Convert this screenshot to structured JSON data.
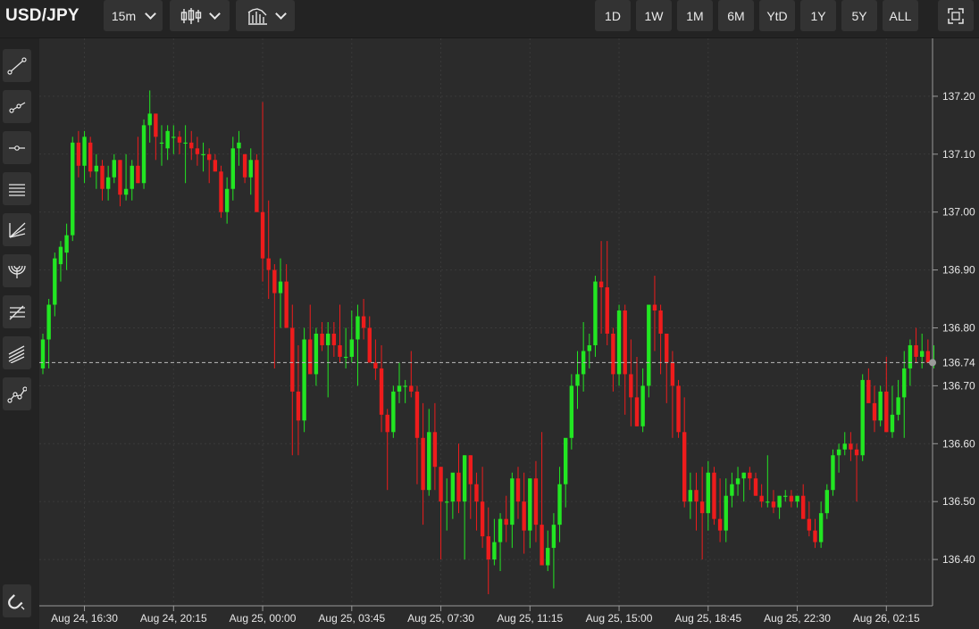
{
  "symbol": "USD/JPY",
  "toolbar": {
    "interval": "15m",
    "chart_type_icon": "candlestick-icon",
    "indicators_icon": "indicators-icon",
    "ranges": [
      "1D",
      "1W",
      "1M",
      "6M",
      "YtD",
      "1Y",
      "5Y",
      "ALL"
    ],
    "fullscreen_icon": "fullscreen-icon"
  },
  "tools": [
    "trend-line-icon",
    "ray-icon",
    "horizontal-line-icon",
    "parallel-channel-icon",
    "pitchfork-icon",
    "fibonacci-arc-icon",
    "fibonacci-retracement-icon",
    "fibonacci-channel-icon",
    "polyline-icon"
  ],
  "magnet_icon": "magnet-icon",
  "colors": {
    "up": "#22e622",
    "down": "#ee1c1c",
    "background": "#2b2b2b",
    "grid": "#3a3a3a",
    "text": "#e6e6e6"
  },
  "chart_data": {
    "type": "candlestick",
    "current_price": 136.74,
    "current_price_label": "136.74",
    "ylim": [
      136.32,
      137.3
    ],
    "yticks": [
      136.4,
      136.5,
      136.6,
      136.7,
      136.8,
      136.9,
      137.0,
      137.1,
      137.2
    ],
    "ytick_labels": [
      "136.40",
      "136.50",
      "136.60",
      "136.70",
      "136.80",
      "136.90",
      "137.00",
      "137.10",
      "137.20"
    ],
    "xtick_labels": [
      "Aug 24, 16:30",
      "Aug 24, 20:15",
      "Aug 25, 00:00",
      "Aug 25, 03:45",
      "Aug 25, 07:30",
      "Aug 25, 11:15",
      "Aug 25, 15:00",
      "Aug 25, 18:45",
      "Aug 25, 22:30",
      "Aug 26, 02:15"
    ],
    "xtick_index": [
      7,
      22,
      37,
      52,
      67,
      82,
      97,
      112,
      127,
      142
    ],
    "candles": [
      [
        136.73,
        136.79,
        136.72,
        136.78
      ],
      [
        136.78,
        136.85,
        136.73,
        136.84
      ],
      [
        136.84,
        136.93,
        136.82,
        136.92
      ],
      [
        136.91,
        136.95,
        136.88,
        136.94
      ],
      [
        136.93,
        136.98,
        136.9,
        136.96
      ],
      [
        136.96,
        137.13,
        136.95,
        137.12
      ],
      [
        137.12,
        137.14,
        137.06,
        137.08
      ],
      [
        137.08,
        137.14,
        137.05,
        137.13
      ],
      [
        137.12,
        137.13,
        137.06,
        137.07
      ],
      [
        137.07,
        137.1,
        137.04,
        137.08
      ],
      [
        137.08,
        137.09,
        137.02,
        137.04
      ],
      [
        137.04,
        137.08,
        137.02,
        137.06
      ],
      [
        137.06,
        137.1,
        137.05,
        137.09
      ],
      [
        137.09,
        137.09,
        137.01,
        137.03
      ],
      [
        137.03,
        137.1,
        137.02,
        137.04
      ],
      [
        137.04,
        137.09,
        137.02,
        137.08
      ],
      [
        137.08,
        137.13,
        137.05,
        137.05
      ],
      [
        137.05,
        137.16,
        137.04,
        137.15
      ],
      [
        137.15,
        137.21,
        137.12,
        137.17
      ],
      [
        137.17,
        137.17,
        137.09,
        137.13
      ],
      [
        137.12,
        137.15,
        137.08,
        137.12
      ],
      [
        137.11,
        137.15,
        137.09,
        137.14
      ],
      [
        137.13,
        137.15,
        137.1,
        137.13
      ],
      [
        137.13,
        137.14,
        137.1,
        137.12
      ],
      [
        137.12,
        137.15,
        137.05,
        137.12
      ],
      [
        137.12,
        137.14,
        137.09,
        137.11
      ],
      [
        137.11,
        137.13,
        137.08,
        137.1
      ],
      [
        137.1,
        137.12,
        137.07,
        137.1
      ],
      [
        137.1,
        137.11,
        137.05,
        137.09
      ],
      [
        137.09,
        137.1,
        137.07,
        137.07
      ],
      [
        137.07,
        137.08,
        136.99,
        137.0
      ],
      [
        137.0,
        137.06,
        136.98,
        137.04
      ],
      [
        137.04,
        137.13,
        137.02,
        137.11
      ],
      [
        137.11,
        137.14,
        137.08,
        137.12
      ],
      [
        137.1,
        137.1,
        137.05,
        137.06
      ],
      [
        137.06,
        137.11,
        137.03,
        137.09
      ],
      [
        137.09,
        137.1,
        137.0,
        137.0
      ],
      [
        137.0,
        137.19,
        136.88,
        136.92
      ],
      [
        136.92,
        137.02,
        136.85,
        136.9
      ],
      [
        136.9,
        136.91,
        136.73,
        136.86
      ],
      [
        136.86,
        136.92,
        136.8,
        136.88
      ],
      [
        136.88,
        136.91,
        136.8,
        136.8
      ],
      [
        136.8,
        136.84,
        136.58,
        136.69
      ],
      [
        136.69,
        136.77,
        136.58,
        136.64
      ],
      [
        136.64,
        136.8,
        136.62,
        136.78
      ],
      [
        136.78,
        136.84,
        136.75,
        136.72
      ],
      [
        136.72,
        136.8,
        136.7,
        136.79
      ],
      [
        136.79,
        136.81,
        136.76,
        136.77
      ],
      [
        136.77,
        136.81,
        136.68,
        136.79
      ],
      [
        136.79,
        136.81,
        136.75,
        136.77
      ],
      [
        136.77,
        136.84,
        136.74,
        136.75
      ],
      [
        136.75,
        136.8,
        136.73,
        136.75
      ],
      [
        136.75,
        136.83,
        136.74,
        136.78
      ],
      [
        136.78,
        136.84,
        136.7,
        136.82
      ],
      [
        136.82,
        136.85,
        136.78,
        136.8
      ],
      [
        136.8,
        136.82,
        136.74,
        136.74
      ],
      [
        136.74,
        136.78,
        136.71,
        136.73
      ],
      [
        136.73,
        136.77,
        136.62,
        136.65
      ],
      [
        136.65,
        136.66,
        136.52,
        136.62
      ],
      [
        136.62,
        136.7,
        136.61,
        136.69
      ],
      [
        136.69,
        136.74,
        136.67,
        136.7
      ],
      [
        136.7,
        136.71,
        136.67,
        136.7
      ],
      [
        136.7,
        136.76,
        136.68,
        136.69
      ],
      [
        136.69,
        136.7,
        136.53,
        136.61
      ],
      [
        136.61,
        136.67,
        136.46,
        136.52
      ],
      [
        136.52,
        136.66,
        136.51,
        136.62
      ],
      [
        136.62,
        136.67,
        136.52,
        136.56
      ],
      [
        136.56,
        136.56,
        136.4,
        136.5
      ],
      [
        136.5,
        136.54,
        136.45,
        136.5
      ],
      [
        136.5,
        136.54,
        136.47,
        136.55
      ],
      [
        136.55,
        136.6,
        136.48,
        136.5
      ],
      [
        136.5,
        136.58,
        136.4,
        136.58
      ],
      [
        136.58,
        136.58,
        136.47,
        136.53
      ],
      [
        136.53,
        136.55,
        136.45,
        136.5
      ],
      [
        136.5,
        136.56,
        136.42,
        136.44
      ],
      [
        136.44,
        136.49,
        136.34,
        136.4
      ],
      [
        136.4,
        136.47,
        136.39,
        136.43
      ],
      [
        136.43,
        136.48,
        136.38,
        136.47
      ],
      [
        136.47,
        136.51,
        136.43,
        136.46
      ],
      [
        136.46,
        136.55,
        136.42,
        136.54
      ],
      [
        136.54,
        136.56,
        136.47,
        136.5
      ],
      [
        136.5,
        136.55,
        136.41,
        136.45
      ],
      [
        136.45,
        136.54,
        136.42,
        136.54
      ],
      [
        136.54,
        136.57,
        136.43,
        136.46
      ],
      [
        136.46,
        136.62,
        136.4,
        136.39
      ],
      [
        136.39,
        136.45,
        136.38,
        136.42
      ],
      [
        136.42,
        136.48,
        136.35,
        136.46
      ],
      [
        136.46,
        136.56,
        136.43,
        136.53
      ],
      [
        136.53,
        136.6,
        136.49,
        136.61
      ],
      [
        136.61,
        136.72,
        136.59,
        136.7
      ],
      [
        136.7,
        136.76,
        136.66,
        136.72
      ],
      [
        136.72,
        136.81,
        136.69,
        136.76
      ],
      [
        136.76,
        136.79,
        136.73,
        136.77
      ],
      [
        136.77,
        136.89,
        136.75,
        136.88
      ],
      [
        136.88,
        136.95,
        136.79,
        136.87
      ],
      [
        136.87,
        136.95,
        136.77,
        136.79
      ],
      [
        136.79,
        136.8,
        136.69,
        136.72
      ],
      [
        136.72,
        136.84,
        136.7,
        136.83
      ],
      [
        136.83,
        136.84,
        136.65,
        136.72
      ],
      [
        136.72,
        136.78,
        136.63,
        136.68
      ],
      [
        136.68,
        136.75,
        136.63,
        136.63
      ],
      [
        136.63,
        136.73,
        136.62,
        136.7
      ],
      [
        136.7,
        136.83,
        136.68,
        136.84
      ],
      [
        136.84,
        136.89,
        136.76,
        136.83
      ],
      [
        136.83,
        136.84,
        136.72,
        136.79
      ],
      [
        136.79,
        136.79,
        136.67,
        136.74
      ],
      [
        136.74,
        136.76,
        136.61,
        136.7
      ],
      [
        136.7,
        136.71,
        136.61,
        136.62
      ],
      [
        136.62,
        136.68,
        136.49,
        136.5
      ],
      [
        136.5,
        136.55,
        136.47,
        136.52
      ],
      [
        136.52,
        136.55,
        136.45,
        136.5
      ],
      [
        136.5,
        136.56,
        136.4,
        136.48
      ],
      [
        136.48,
        136.57,
        136.45,
        136.55
      ],
      [
        136.55,
        136.56,
        136.46,
        136.47
      ],
      [
        136.47,
        136.54,
        136.43,
        136.45
      ],
      [
        136.45,
        136.54,
        136.43,
        136.51
      ],
      [
        136.51,
        136.55,
        136.49,
        136.53
      ],
      [
        136.53,
        136.56,
        136.51,
        136.54
      ],
      [
        136.54,
        136.55,
        136.5,
        136.55
      ],
      [
        136.55,
        136.56,
        136.52,
        136.54
      ],
      [
        136.54,
        136.55,
        136.51,
        136.51
      ],
      [
        136.51,
        136.53,
        136.49,
        136.5
      ],
      [
        136.5,
        136.58,
        136.49,
        136.5
      ],
      [
        136.5,
        136.52,
        136.48,
        136.49
      ],
      [
        136.49,
        136.51,
        136.47,
        136.51
      ],
      [
        136.51,
        136.52,
        136.5,
        136.51
      ],
      [
        136.51,
        136.52,
        136.49,
        136.5
      ],
      [
        136.5,
        136.51,
        136.49,
        136.51
      ],
      [
        136.51,
        136.53,
        136.47,
        136.47
      ],
      [
        136.47,
        136.5,
        136.44,
        136.45
      ],
      [
        136.45,
        136.47,
        136.42,
        136.43
      ],
      [
        136.43,
        136.5,
        136.42,
        136.48
      ],
      [
        136.48,
        136.53,
        136.47,
        136.52
      ],
      [
        136.52,
        136.59,
        136.51,
        136.58
      ],
      [
        136.58,
        136.6,
        136.55,
        136.59
      ],
      [
        136.59,
        136.62,
        136.58,
        136.6
      ],
      [
        136.6,
        136.62,
        136.57,
        136.59
      ],
      [
        136.59,
        136.6,
        136.5,
        136.58
      ],
      [
        136.58,
        136.72,
        136.57,
        136.71
      ],
      [
        136.71,
        136.73,
        136.68,
        136.67
      ],
      [
        136.67,
        136.7,
        136.62,
        136.64
      ],
      [
        136.64,
        136.7,
        136.63,
        136.69
      ],
      [
        136.69,
        136.75,
        136.67,
        136.62
      ],
      [
        136.62,
        136.7,
        136.61,
        136.65
      ],
      [
        136.65,
        136.71,
        136.64,
        136.68
      ],
      [
        136.68,
        136.76,
        136.61,
        136.73
      ],
      [
        136.73,
        136.78,
        136.7,
        136.77
      ],
      [
        136.77,
        136.8,
        136.74,
        136.75
      ],
      [
        136.75,
        136.79,
        136.73,
        136.76
      ],
      [
        136.76,
        136.78,
        136.74,
        136.74
      ],
      [
        136.74,
        136.77,
        136.73,
        136.74
      ]
    ]
  }
}
